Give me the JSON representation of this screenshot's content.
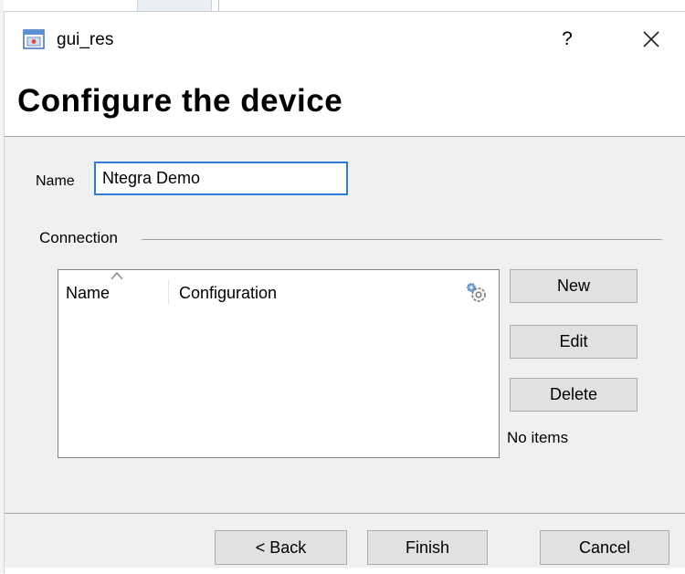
{
  "window": {
    "title": "gui_res",
    "help_label": "?"
  },
  "page": {
    "heading": "Configure the device"
  },
  "form": {
    "name_label": "Name",
    "name_value": "Ntegra Demo"
  },
  "connection": {
    "group_label": "Connection",
    "columns": [
      "Name",
      "Configuration"
    ],
    "rows": [],
    "status": "No items",
    "buttons": {
      "new": "New",
      "edit": "Edit",
      "delete": "Delete"
    }
  },
  "footer": {
    "back": "< Back",
    "finish": "Finish",
    "cancel": "Cancel"
  },
  "colors": {
    "input_focus_border": "#2f7ad6",
    "panel_bg": "#f0f0f0",
    "button_bg": "#e1e1e1"
  },
  "icons": {
    "app": "app-window-icon",
    "help": "help-icon",
    "close": "close-icon",
    "column_settings": "gear-icon",
    "sort": "sort-caret-icon"
  }
}
